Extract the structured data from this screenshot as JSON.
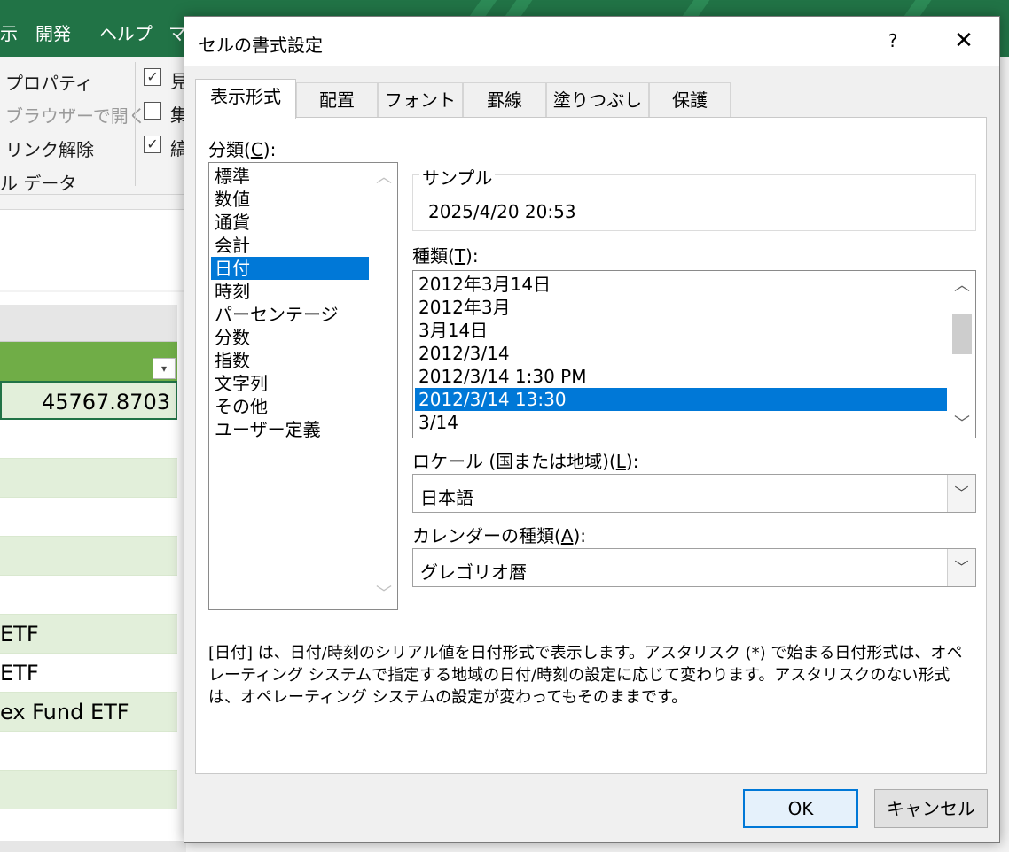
{
  "excel": {
    "ribbon_tabs": [
      "示",
      "開発",
      "ヘルプ",
      "マ"
    ],
    "ribbon_items": {
      "properties": "プロパティ",
      "open_in_browser": "ブラウザーで開く",
      "unlink": "リンク解除",
      "data": "ル データ",
      "cb1": "見",
      "cb2": "集",
      "cb3": "縞"
    },
    "cells": {
      "value": "45767.8703",
      "etf1": "ETF",
      "etf2": "ETF",
      "etf3": "ex Fund ETF"
    }
  },
  "dialog": {
    "title": "セルの書式設定",
    "help": "?",
    "close": "✕",
    "tabs": [
      "表示形式",
      "配置",
      "フォント",
      "罫線",
      "塗りつぶし",
      "保護"
    ],
    "category_label_prefix": "分類(",
    "category_label_key": "C",
    "category_label_suffix": "):",
    "categories": [
      "標準",
      "数値",
      "通貨",
      "会計",
      "日付",
      "時刻",
      "パーセンテージ",
      "分数",
      "指数",
      "文字列",
      "その他",
      "ユーザー定義"
    ],
    "selected_category": "日付",
    "sample_label": "サンプル",
    "sample_value": "2025/4/20 20:53",
    "type_label_prefix": "種類(",
    "type_label_key": "T",
    "type_label_suffix": "):",
    "types": [
      "2012年3月14日",
      "2012年3月",
      "3月14日",
      "2012/3/14",
      "2012/3/14 1:30 PM",
      "2012/3/14 13:30",
      "3/14"
    ],
    "selected_type": "2012/3/14 13:30",
    "locale_label_prefix": "ロケール (国または地域)(",
    "locale_label_key": "L",
    "locale_label_suffix": "):",
    "locale_value": "日本語",
    "calendar_label_prefix": "カレンダーの種類(",
    "calendar_label_key": "A",
    "calendar_label_suffix": "):",
    "calendar_value": "グレゴリオ暦",
    "description": "[日付] は、日付/時刻のシリアル値を日付形式で表示します。アスタリスク (*) で始まる日付形式は、オペレーティング システムで指定する地域の日付/時刻の設定に応じて変わります。アスタリスクのない形式は、オペレーティング システムの設定が変わってもそのままです。",
    "ok_label": "OK",
    "cancel_label": "キャンセル",
    "accent_color": "#0078d7",
    "excel_green": "#217346"
  }
}
